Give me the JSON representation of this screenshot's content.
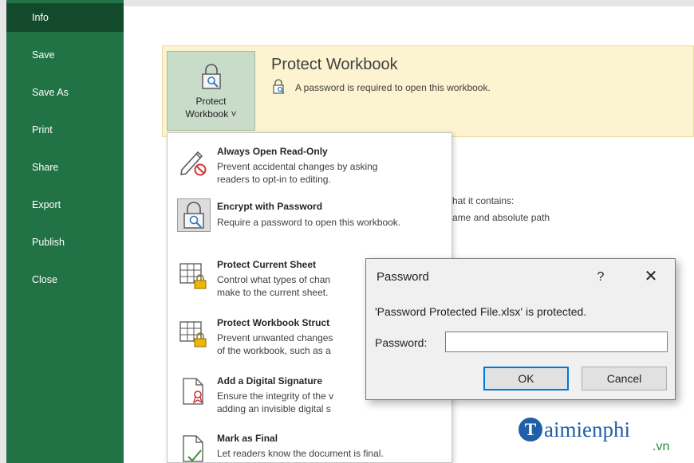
{
  "sidebar": {
    "items": [
      {
        "label": "Info"
      },
      {
        "label": "Save"
      },
      {
        "label": "Save As"
      },
      {
        "label": "Print"
      },
      {
        "label": "Share"
      },
      {
        "label": "Export"
      },
      {
        "label": "Publish"
      },
      {
        "label": "Close"
      }
    ]
  },
  "protect": {
    "button_line1": "Protect",
    "button_line2": "Workbook ˅",
    "title": "Protect Workbook",
    "description": "A password is required to open this workbook."
  },
  "background_text": {
    "line1": "hat it contains:",
    "line2": "ame and absolute path"
  },
  "menu": {
    "items": [
      {
        "title": "Always Open Read-Only",
        "desc": "Prevent accidental changes by asking\nreaders to opt-in to editing.",
        "icon": "pencil-no-icon"
      },
      {
        "title": "Encrypt with Password",
        "desc": "Require a password to open this workbook.",
        "icon": "lock-search-icon"
      },
      {
        "title": "Protect Current Sheet",
        "desc": "Control what types of chan\nmake to the current sheet.",
        "icon": "sheet-lock-icon"
      },
      {
        "title": "Protect Workbook Struct",
        "desc": "Prevent unwanted changes\nof the workbook, such as a",
        "icon": "workbook-lock-icon"
      },
      {
        "title": "Add a Digital Signature",
        "desc": "Ensure the integrity of the v\nadding an invisible digital s",
        "icon": "signature-icon"
      },
      {
        "title": "Mark as Final",
        "desc": "Let readers know the document is final.",
        "icon": "document-final-icon"
      }
    ]
  },
  "dialog": {
    "title": "Password",
    "help": "?",
    "close": "✕",
    "message": "'Password Protected File.xlsx' is protected.",
    "password_label": "Password:",
    "password_value": "",
    "ok_label": "OK",
    "cancel_label": "Cancel"
  },
  "watermark": {
    "brand": "aimienphi",
    "suffix": ".vn"
  },
  "colors": {
    "sidebar": "#217346",
    "sidebar_active": "#124a2b",
    "protect_strip": "#fcf3d0",
    "ok_border": "#0078d7"
  }
}
